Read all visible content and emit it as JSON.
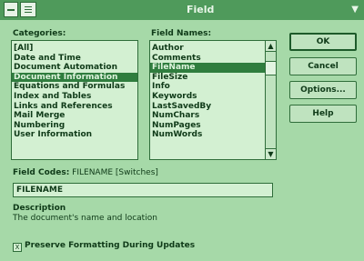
{
  "window": {
    "title": "Field"
  },
  "labels": {
    "categories": "Categories:",
    "field_names": "Field Names:",
    "field_codes_prefix": "Field Codes:",
    "field_codes_syntax": "FILENAME [Switches]",
    "description_heading": "Description",
    "description_text": "The document's name and location",
    "preserve": "Preserve Formatting During Updates"
  },
  "categories": [
    {
      "label": "[All]"
    },
    {
      "label": "Date and Time"
    },
    {
      "label": "Document Automation"
    },
    {
      "label": "Document Information",
      "selected": true
    },
    {
      "label": "Equations and Formulas"
    },
    {
      "label": "Index and Tables"
    },
    {
      "label": "Links and References"
    },
    {
      "label": "Mail Merge"
    },
    {
      "label": "Numbering"
    },
    {
      "label": "User Information"
    }
  ],
  "field_names": [
    {
      "label": "Author"
    },
    {
      "label": "Comments"
    },
    {
      "label": "FileName",
      "selected": true
    },
    {
      "label": "FileSize"
    },
    {
      "label": "Info"
    },
    {
      "label": "Keywords"
    },
    {
      "label": "LastSavedBy"
    },
    {
      "label": "NumChars"
    },
    {
      "label": "NumPages"
    },
    {
      "label": "NumWords"
    }
  ],
  "field_codes_value": "FILENAME",
  "buttons": {
    "ok": "OK",
    "cancel": "Cancel",
    "options": "Options...",
    "help": "Help"
  },
  "preserve_checked": true,
  "icons": {
    "checkbox_mark": "X",
    "scroll_up": "▲",
    "scroll_down": "▼",
    "corner": "▼"
  },
  "colors": {
    "title_bar": "#4f9a5b",
    "background": "#a6d9a8",
    "selection": "#2f7d3e"
  }
}
